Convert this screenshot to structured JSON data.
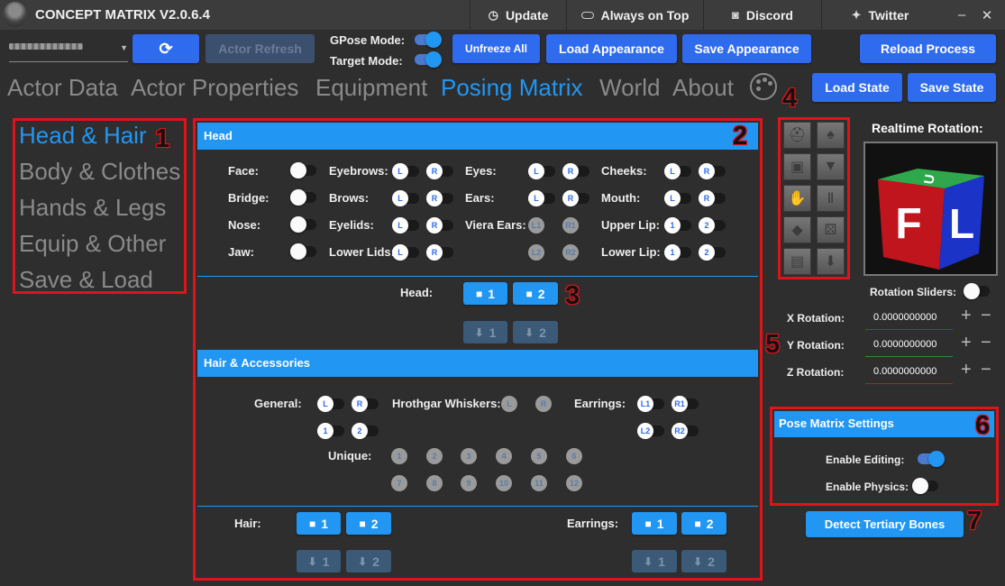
{
  "app": {
    "title": "CONCEPT MATRIX V2.0.6.4"
  },
  "titlebar": {
    "update": "Update",
    "always_on_top": "Always on Top",
    "discord": "Discord",
    "twitter": "Twitter",
    "minimize": "–",
    "close": "✕"
  },
  "toolbar": {
    "refresh_icon": "refresh-icon",
    "actor_refresh": "Actor Refresh",
    "gpose_mode": "GPose Mode:",
    "target_mode": "Target Mode:",
    "unfreeze_all": "Unfreeze All",
    "load_appearance": "Load Appearance",
    "save_appearance": "Save Appearance",
    "reload_process": "Reload Process",
    "gpose_on": true,
    "target_on": true
  },
  "tabs": [
    "Actor Data",
    "Actor Properties",
    "Equipment",
    "Posing Matrix",
    "World",
    "About"
  ],
  "active_tab": "Posing Matrix",
  "state_buttons": {
    "load": "Load State",
    "save": "Save State"
  },
  "sidebar": {
    "items": [
      "Head & Hair",
      "Body & Clothes",
      "Hands & Legs",
      "Equip & Other",
      "Save & Load"
    ],
    "active": "Head & Hair"
  },
  "callouts": [
    "1",
    "2",
    "3",
    "4",
    "5",
    "6",
    "7"
  ],
  "head": {
    "title": "Head",
    "col1": [
      "Face:",
      "Bridge:",
      "Nose:",
      "Jaw:"
    ],
    "col2": [
      "Eyebrows:",
      "Brows:",
      "Eyelids:",
      "Lower Lids:"
    ],
    "col3": [
      "Eyes:",
      "Ears:",
      "Viera Ears:",
      ""
    ],
    "col4": [
      "Cheeks:",
      "Mouth:",
      "Upper Lip:",
      "Lower Lip:"
    ],
    "L": "L",
    "R": "R",
    "L1": "L1",
    "R1": "R1",
    "L2": "L2",
    "R2": "R2",
    "one": "1",
    "two": "2",
    "save_label": "Head:"
  },
  "hair": {
    "title": "Hair & Accessories",
    "general": "General:",
    "hrothgar": "Hrothgar Whiskers:",
    "earrings": "Earrings:",
    "unique": "Unique:",
    "unique_nums": [
      "1",
      "2",
      "3",
      "4",
      "5",
      "6",
      "7",
      "8",
      "9",
      "10",
      "11",
      "12"
    ],
    "hair_label": "Hair:",
    "earrings_label": "Earrings:"
  },
  "rotation": {
    "title": "Realtime Rotation:",
    "sliders": "Rotation Sliders:",
    "x_label": "X Rotation:",
    "y_label": "Y Rotation:",
    "z_label": "Z Rotation:",
    "x": "0.0000000000",
    "y": "0.0000000000",
    "z": "0.0000000000",
    "cube_front": "F",
    "cube_right": "L",
    "cube_top": "U"
  },
  "pose_settings": {
    "title": "Pose Matrix Settings",
    "enable_editing": "Enable Editing:",
    "enable_physics": "Enable Physics:",
    "editing_on": true,
    "physics_on": false
  },
  "detect_tertiary": "Detect Tertiary Bones",
  "colors": {
    "accent": "#2196f3",
    "button": "#2f6bef",
    "callout": "#e0131a",
    "bg": "#2e2e2e"
  }
}
